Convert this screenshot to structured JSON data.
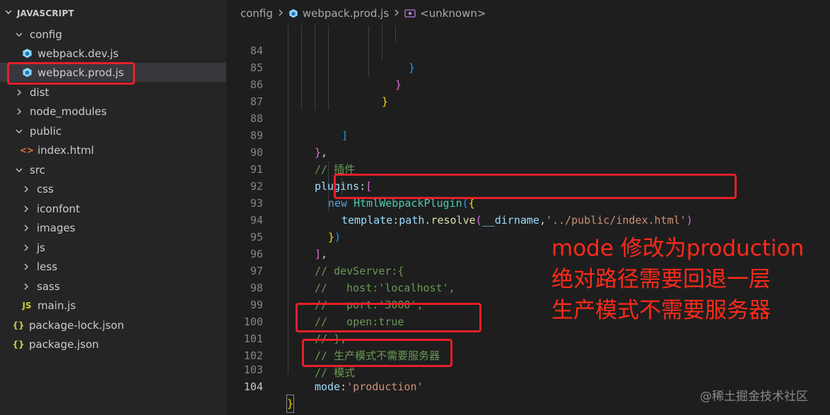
{
  "explorer": {
    "title": "JAVASCRIPT",
    "items": [
      {
        "label": "config"
      },
      {
        "label": "webpack.dev.js"
      },
      {
        "label": "webpack.prod.js"
      },
      {
        "label": "dist"
      },
      {
        "label": "node_modules"
      },
      {
        "label": "public"
      },
      {
        "label": "index.html"
      },
      {
        "label": "src"
      },
      {
        "label": "css"
      },
      {
        "label": "iconfont"
      },
      {
        "label": "images"
      },
      {
        "label": "js"
      },
      {
        "label": "less"
      },
      {
        "label": "sass"
      },
      {
        "label": "main.js"
      },
      {
        "label": "package-lock.json"
      },
      {
        "label": "package.json"
      }
    ],
    "icons": {
      "html": "<>",
      "js": "JS",
      "json": "{}"
    }
  },
  "breadcrumb": {
    "folder": "config",
    "file": "webpack.prod.js",
    "symbol": "<unknown>"
  },
  "code": {
    "line_numbers": [
      "84",
      "85",
      "86",
      "87",
      "88",
      "89",
      "90",
      "91",
      "92",
      "93",
      "94",
      "95",
      "96",
      "97",
      "98",
      "99",
      "100",
      "101",
      "102",
      "103",
      "104"
    ],
    "lines": [
      [
        "}"
      ],
      [
        "}"
      ],
      [
        "}"
      ],
      [],
      [
        "]"
      ],
      [
        "}",
        ","
      ],
      [
        "// 插件"
      ],
      [
        "plugins",
        ":",
        "["
      ],
      [
        "new",
        " ",
        "HtmlWebpackPlugin",
        "(",
        "{"
      ],
      [
        "template",
        ":",
        "path",
        ".",
        "resolve",
        "(",
        "__dirname",
        ",",
        "'../public/index.html'",
        ")"
      ],
      [
        "}",
        ")"
      ],
      [
        "]",
        ","
      ],
      [
        "// devServer:{"
      ],
      [
        "//   host:'localhost',"
      ],
      [
        "//   port:'3000',"
      ],
      [
        "//   open:true"
      ],
      [
        "// },"
      ],
      [
        "// 生产模式不需要服务器"
      ],
      [
        "// 模式"
      ],
      [
        "mode",
        ":",
        "'production'"
      ],
      [
        "}"
      ]
    ]
  },
  "annotations": {
    "lines": [
      "mode 修改为production",
      "绝对路径需要回退一层",
      "生产模式不需要服务器"
    ],
    "color": "#ff2a1a"
  },
  "watermark": "@稀土掘金技术社区"
}
